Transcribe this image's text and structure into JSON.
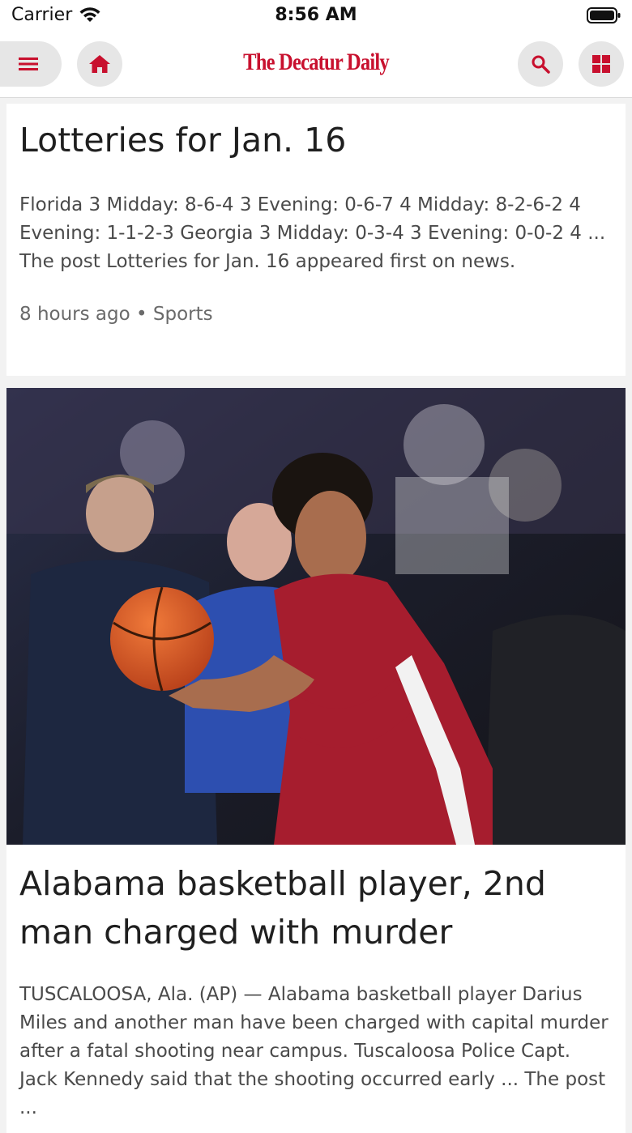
{
  "status_bar": {
    "carrier": "Carrier",
    "time": "8:56 AM"
  },
  "header": {
    "logo": "The Decatur Daily",
    "icons": [
      "menu-icon",
      "home-icon",
      "search-icon",
      "grid-icon"
    ],
    "accent_color": "#c8102e"
  },
  "articles": [
    {
      "headline": "Lotteries for Jan. 16",
      "summary": "Florida 3 Midday: 8-6-4 3 Evening: 0-6-7 4 Midday: 8-2-6-2 4 Evening: 1-1-2-3 Georgia 3 Midday: 0-3-4 3 Evening: 0-0-2 4 ... The post Lotteries for Jan. 16 appeared first on news.",
      "time": "8 hours ago",
      "separator": "•",
      "category": "Sports"
    },
    {
      "image": "basketball-player-photo",
      "headline": "Alabama basketball player, 2nd man charged with murder",
      "summary": "TUSCALOOSA, Ala. (AP) — Alabama basketball player Darius Miles and another man have been charged with capital murder after a fatal shooting near campus. Tuscaloosa Police Capt. Jack Kennedy said that the shooting occurred early ... The post ..."
    }
  ]
}
